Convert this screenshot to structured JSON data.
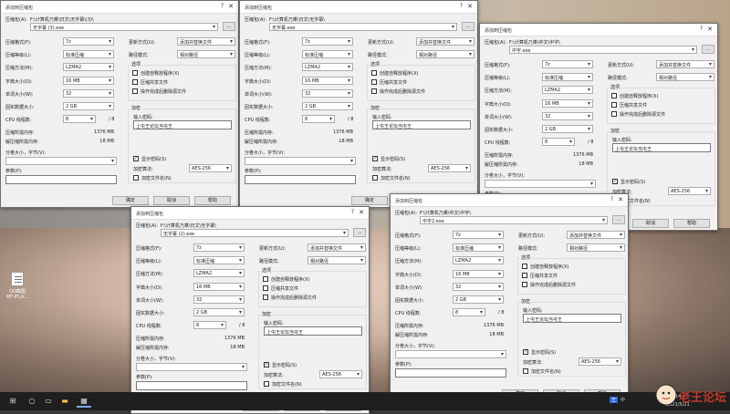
{
  "desktop": {
    "icon_label_1": "OO截图",
    "icon_label_2": "MT-IFLA..."
  },
  "dialog": {
    "title": "添加到压缩包",
    "archive_label": "压缩包(A):",
    "browse_label": "...",
    "format_label": "压缩格式(F):",
    "format_value": "7z",
    "level_label": "压缩等级(L):",
    "level_value": "标准压缩",
    "method_label": "压缩方法(M):",
    "method_value": "LZMA2",
    "dict_label": "字典大小(D):",
    "dict_value": "16 MB",
    "word_label": "单词大小(W):",
    "word_value": "32",
    "solid_label": "固实数据大小:",
    "solid_value": "2 GB",
    "cpu_label": "CPU 线程数:",
    "cpu_value": "8",
    "cpu_max": "/ 8",
    "mem_comp_label": "压缩所需内存:",
    "mem_comp_value": "1376 MB",
    "mem_decomp_label": "解压缩所需内存:",
    "mem_decomp_value": "18 MB",
    "split_label": "分卷大小，字节(V):",
    "params_label": "参数(P):",
    "update_label": "更新方式(U):",
    "update_value": "添加并替换文件",
    "path_label": "路径模式:",
    "path_value": "相对路径",
    "options_label": "选项",
    "opt_sfx": "创建自释放程序(X)",
    "opt_shared": "压缩共享文件",
    "opt_delete": "操作完成后删除源文件",
    "encrypt_label": "加密",
    "pwd_label": "输入密码:",
    "pwd_value": "上屯王论坛当屯王",
    "show_pwd": "显示密码(S)",
    "enc_method_label": "加密算法:",
    "enc_method_value": "AES-256",
    "enc_names": "加密文件名(N)",
    "ok_label": "确定",
    "cancel_label": "取消",
    "help_label": "帮助"
  },
  "windows": [
    {
      "path_line": "F:\\计算机乃乘\\日文\\无字幕\\(3)\\",
      "archive_value": "无字幕 (3).exe"
    },
    {
      "path_line": "F:\\计算机乃乘\\日文\\无字幕\\",
      "archive_value": "无字幕.exe"
    },
    {
      "path_line": "F:\\计算机乃乘\\中文\\中字\\",
      "archive_value": "中字.exe"
    },
    {
      "path_line": "F:\\计算机乃乘\\日文\\无字幕\\",
      "archive_value": "无字幕 (2).exe"
    },
    {
      "path_line": "F:\\计算机乃乘\\中文\\中字\\",
      "archive_value": "中字2.exe"
    }
  ],
  "taskbar": {
    "start_icon": "windows-logo",
    "search_icon": "search",
    "ime": "王",
    "lang": "中",
    "time": "14",
    "date": "2021/5/21"
  },
  "watermark": {
    "text": "老王论坛"
  }
}
